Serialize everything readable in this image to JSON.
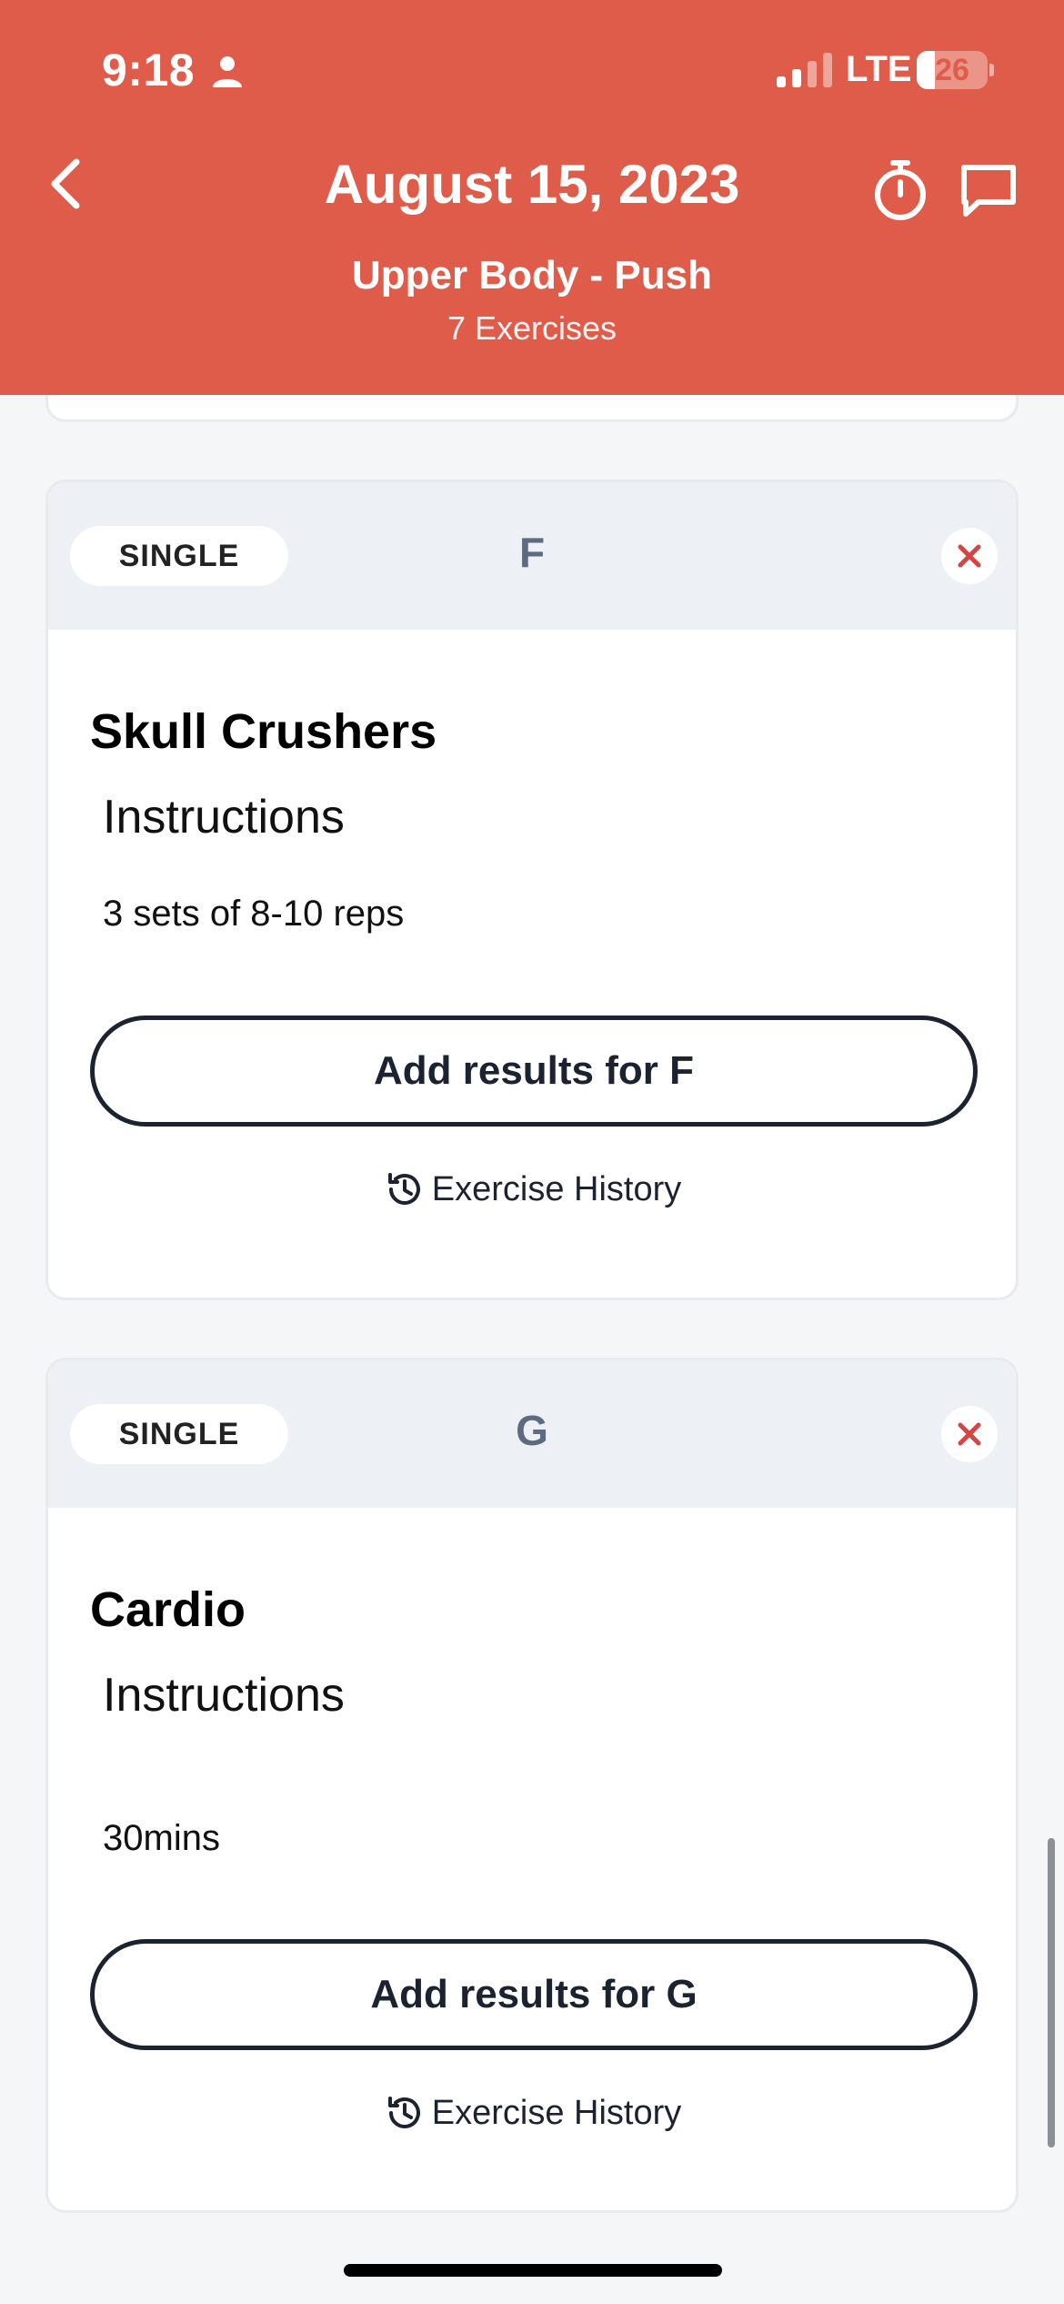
{
  "status_bar": {
    "time": "9:18",
    "network": "LTE",
    "battery": "26",
    "battery_level_percent": 26
  },
  "header": {
    "date": "August 15, 2023",
    "workout_name": "Upper Body - Push",
    "exercise_count": "7 Exercises",
    "accent_color": "#e05c4a"
  },
  "cards": [
    {
      "type_label": "SINGLE",
      "letter": "F",
      "title": "Skull Crushers",
      "instructions_heading": "Instructions",
      "instructions": "3 sets of 8-10 reps",
      "add_results_label": "Add results for F",
      "history_label": "Exercise History"
    },
    {
      "type_label": "SINGLE",
      "letter": "G",
      "title": "Cardio",
      "instructions_heading": "Instructions",
      "instructions": "30mins",
      "add_results_label": "Add results for G",
      "history_label": "Exercise History"
    }
  ],
  "icons": {
    "back": "chevron-left-icon",
    "timer": "stopwatch-icon",
    "chat": "chat-bubble-icon",
    "remove": "close-icon",
    "history": "history-clock-icon"
  }
}
